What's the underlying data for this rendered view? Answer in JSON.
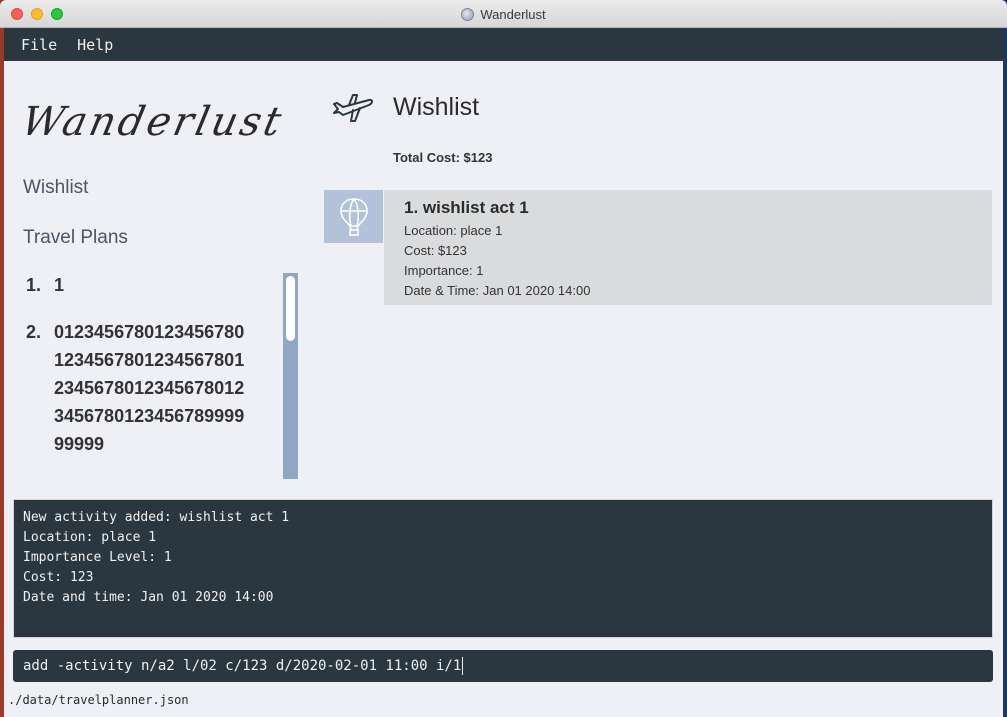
{
  "window": {
    "title": "Wanderlust"
  },
  "menu": {
    "file": "File",
    "help": "Help"
  },
  "logo_text": "Wanderlust",
  "nav": {
    "wishlist": "Wishlist",
    "travel_plans": "Travel Plans"
  },
  "travel_plans": [
    {
      "num": "1.",
      "name": "1"
    },
    {
      "num": "2.",
      "name": "012345678012345678012345678012345678012345678012345678012345678012345678999999999"
    }
  ],
  "main": {
    "title": "Wishlist",
    "total_cost": "Total Cost: $123",
    "activity": {
      "title": "1.  wishlist act 1",
      "location": "Location: place 1",
      "cost": "Cost: $123",
      "importance": "Importance: 1",
      "datetime": "Date & Time: Jan 01 2020 14:00"
    }
  },
  "result_lines": [
    "New activity added: wishlist act 1",
    "Location: place 1",
    "Importance Level: 1",
    "Cost: 123",
    "Date and time: Jan 01 2020 14:00"
  ],
  "command": "add -activity n/a2 l/02 c/123 d/2020-02-01 11:00 i/1",
  "status": "./data/travelplanner.json",
  "icons": {
    "nav_icon": "airplane-icon",
    "card_icon": "hot-air-balloon-icon",
    "app_icon": "globe-icon"
  },
  "colors": {
    "menubar": "#2b3740",
    "card_icon_bg": "#b3c2d8",
    "card_bg": "#dadbdd",
    "scrollbar": "#8fa6c5"
  }
}
